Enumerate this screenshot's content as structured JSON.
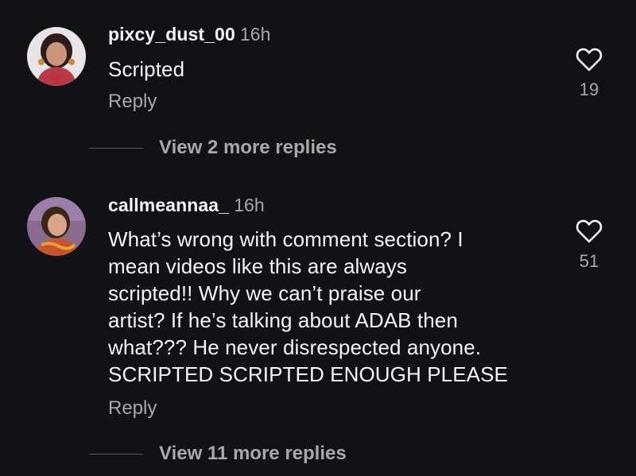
{
  "comments": [
    {
      "username": "pixcy_dust_00",
      "time": "16h",
      "text": "Scripted",
      "reply_label": "Reply",
      "likes": "19",
      "view_more": "View 2 more replies"
    },
    {
      "username": "callmeannaa_",
      "time": "16h",
      "text": "What’s wrong with comment section? I\nmean videos like this are always\nscripted!! Why we can’t praise our\nartist? If he’s talking about ADAB then\nwhat??? He never disrespected anyone.\nSCRIPTED SCRIPTED ENOUGH PLEASE",
      "reply_label": "Reply",
      "likes": "51",
      "view_more": "View 11 more replies"
    }
  ],
  "icons": {
    "like": "heart-outline-icon"
  },
  "colors": {
    "background": "#101215",
    "primary_text": "#f5f5f5",
    "secondary_text": "#a8a8a8"
  }
}
